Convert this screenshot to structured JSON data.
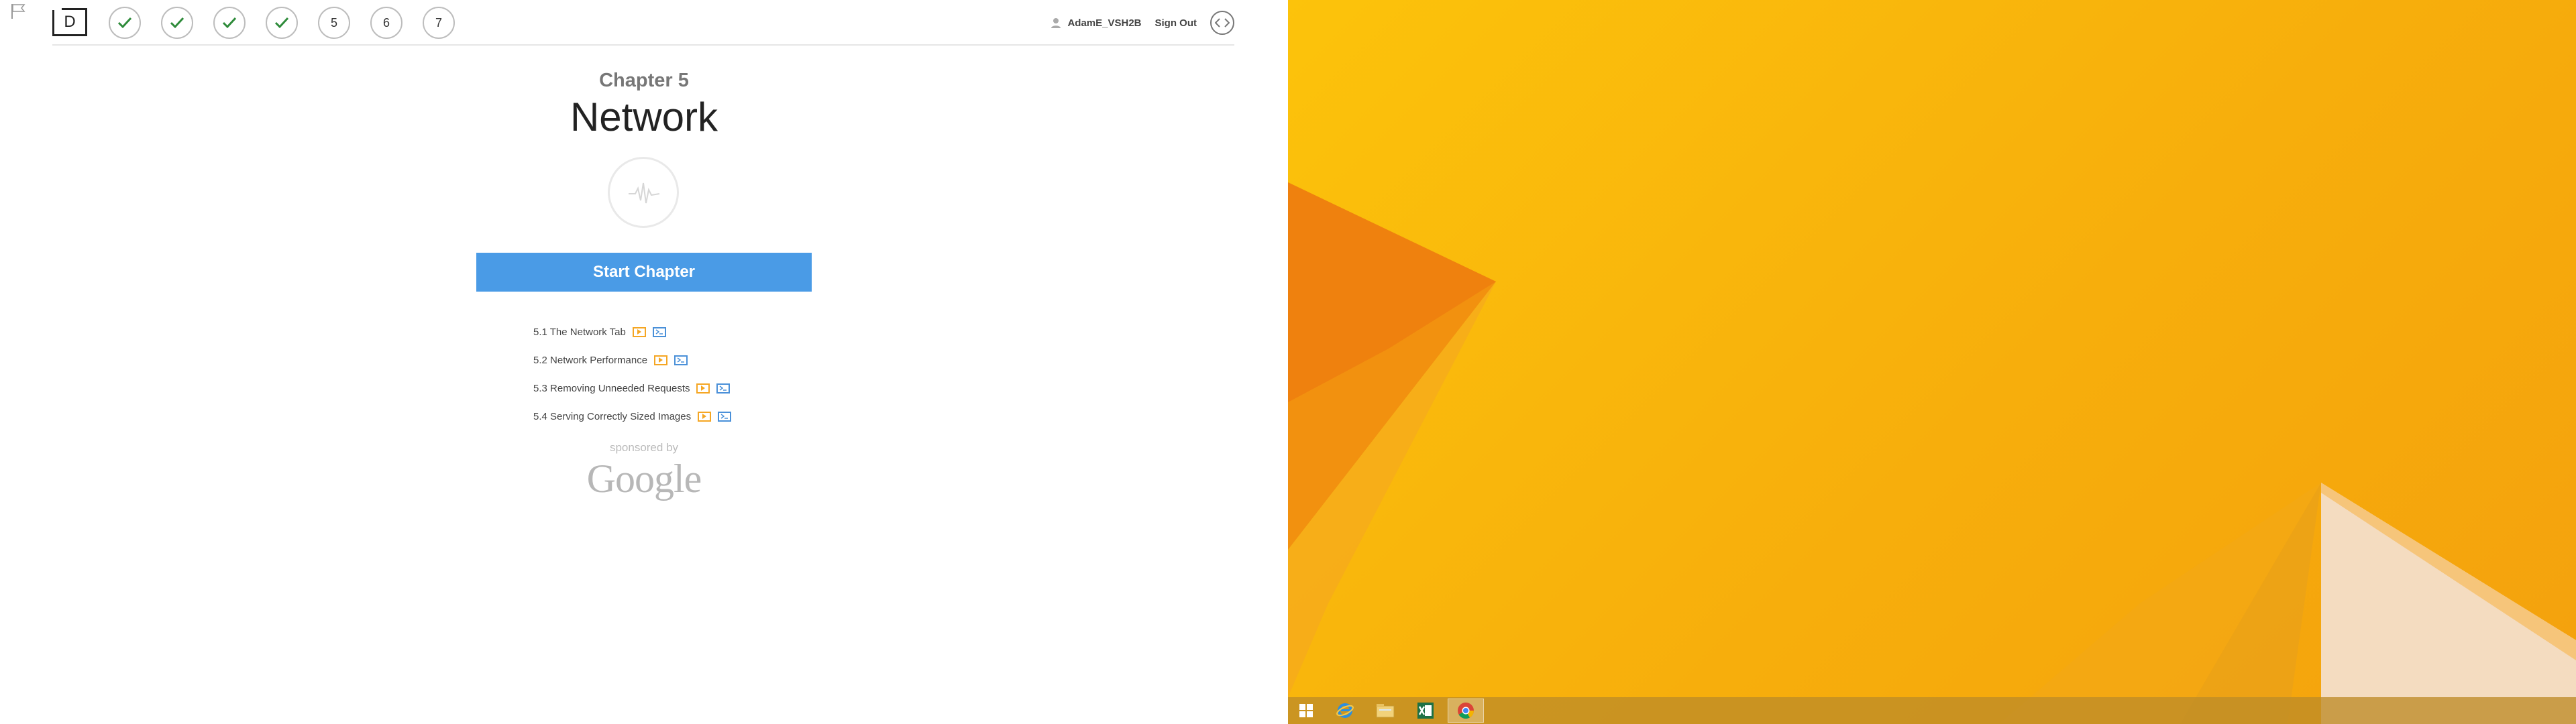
{
  "header": {
    "logo_letter": "D",
    "chapters": [
      {
        "label": "",
        "done": true
      },
      {
        "label": "",
        "done": true
      },
      {
        "label": "",
        "done": true
      },
      {
        "label": "",
        "done": true
      },
      {
        "label": "5",
        "done": false
      },
      {
        "label": "6",
        "done": false
      },
      {
        "label": "7",
        "done": false
      }
    ],
    "username": "AdamE_VSH2B",
    "signout_label": "Sign Out"
  },
  "chapter": {
    "label": "Chapter 5",
    "title": "Network",
    "start_label": "Start Chapter",
    "lessons": [
      {
        "label": "5.1 The Network Tab"
      },
      {
        "label": "5.2 Network Performance"
      },
      {
        "label": "5.3 Removing Unneeded Requests"
      },
      {
        "label": "5.4 Serving Correctly Sized Images"
      }
    ],
    "sponsor_text": "sponsored by",
    "sponsor_name": "Google"
  },
  "taskbar": {
    "items": [
      "windows-start-icon",
      "internet-explorer-icon",
      "file-explorer-icon",
      "excel-icon",
      "chrome-icon"
    ],
    "active_index": 4
  },
  "colors": {
    "accent_blue": "#4a9be6",
    "check_green": "#2e8b3a",
    "video_orange": "#f5a623",
    "quiz_blue": "#4a90d9",
    "wallpaper_orange": "#f7ae0c"
  }
}
